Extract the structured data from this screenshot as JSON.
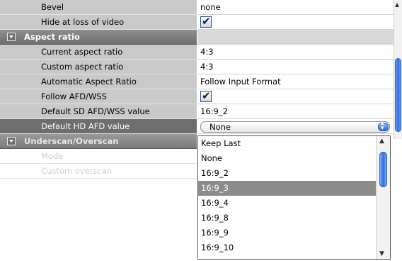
{
  "rows": [
    {
      "label": "Bevel",
      "value": "none"
    },
    {
      "label": "Hide at loss of video",
      "checked": true
    },
    {
      "category": "Aspect ratio"
    },
    {
      "label": "Current aspect ratio",
      "value": "4:3"
    },
    {
      "label": "Custom aspect ratio",
      "value": "4:3"
    },
    {
      "label": "Automatic Aspect Ratio",
      "value": "Follow Input Format"
    },
    {
      "label": "Follow AFD/WSS",
      "checked": true
    },
    {
      "label": "Default SD AFD/WSS value",
      "value": "16:9_2"
    },
    {
      "label": "Default HD AFD value",
      "value": "None",
      "selected": true
    },
    {
      "category": "Underscan/Overscan"
    },
    {
      "label": "Mode"
    },
    {
      "label": "Custom overscan"
    }
  ],
  "dropdown": {
    "options": [
      "Keep Last",
      "None",
      "16:9_2",
      "16:9_3",
      "16:9_4",
      "16:9_8",
      "16:9_9",
      "16:9_10"
    ],
    "highlighted": "16:9_3"
  },
  "colors": {
    "selection": "#6e6e6e",
    "category_header": "#7a7a7a",
    "scroll_thumb": "#2f6ee0"
  }
}
